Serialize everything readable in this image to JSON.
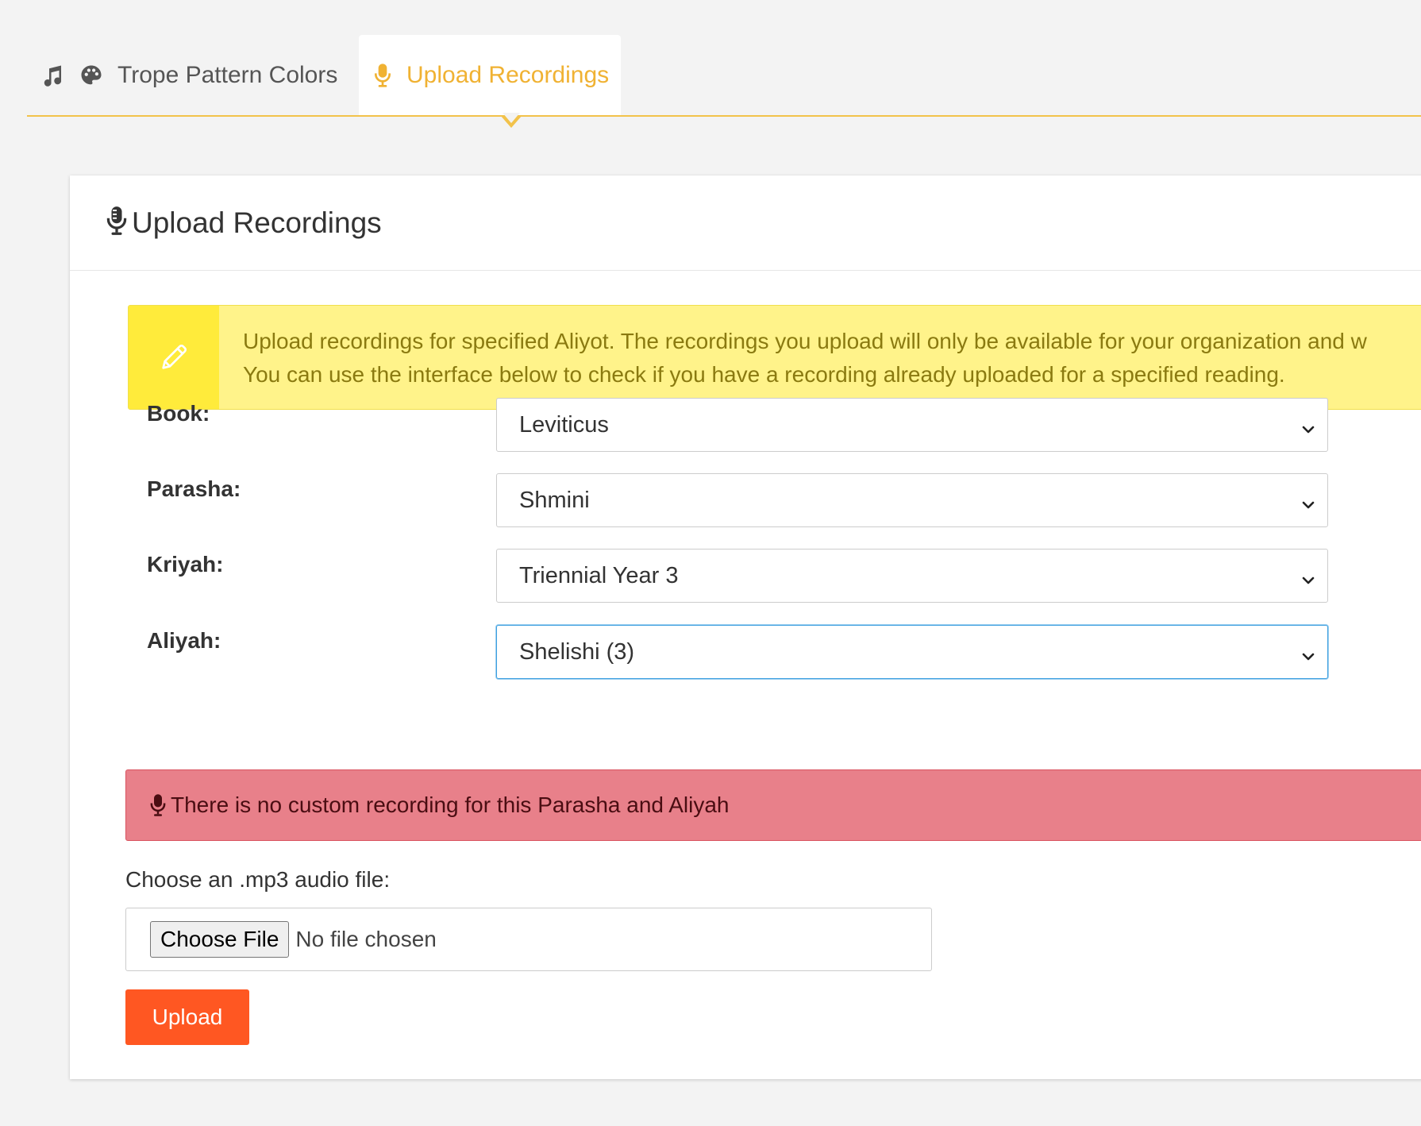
{
  "tabs": [
    {
      "label": "Trope Pattern Colors",
      "icons": [
        "music-note-icon",
        "palette-icon"
      ]
    },
    {
      "label": "Upload Recordings",
      "icon": "microphone-icon",
      "active": true
    }
  ],
  "colors": {
    "accent": "#f0b233",
    "info_bg": "#fff38a",
    "info_icon_bg": "#ffeb3b",
    "danger_bg": "#e8808a",
    "upload_button": "#ff5722",
    "focus_border": "#3ea0e0"
  },
  "card": {
    "title": "Upload Recordings",
    "title_icon": "microphone-icon"
  },
  "info": {
    "icon": "pencil-icon",
    "line1": "Upload recordings for specified Aliyot. The recordings you upload will only be available for your organization and w",
    "line2": "You can use the interface below to check if you have a recording already uploaded for a specified reading."
  },
  "form": {
    "book": {
      "label": "Book:",
      "value": "Leviticus"
    },
    "parasha": {
      "label": "Parasha:",
      "value": "Shmini"
    },
    "kriyah": {
      "label": "Kriyah:",
      "value": "Triennial Year 3"
    },
    "aliyah": {
      "label": "Aliyah:",
      "value": "Shelishi (3)"
    }
  },
  "alert": {
    "icon": "microphone-icon",
    "text": "There is no custom recording for this Parasha and Aliyah"
  },
  "file": {
    "label": "Choose an .mp3 audio file:",
    "button": "Choose File",
    "status": "No file chosen"
  },
  "upload_button": "Upload"
}
